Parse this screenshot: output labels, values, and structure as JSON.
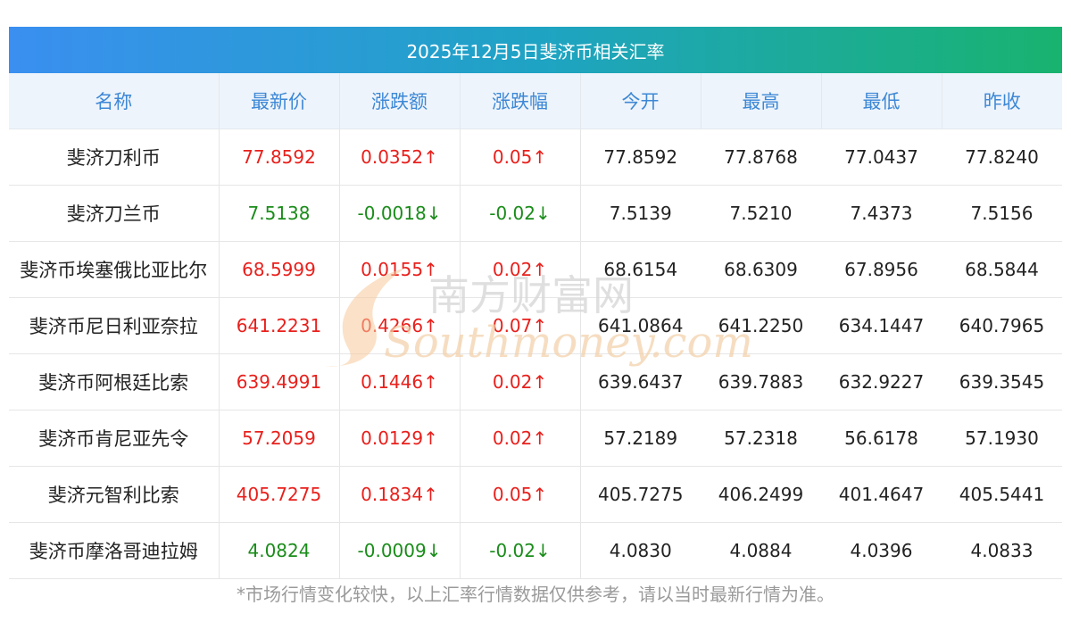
{
  "title": "2025年12月5日斐济币相关汇率",
  "columns": [
    "名称",
    "最新价",
    "涨跌额",
    "涨跌幅",
    "今开",
    "最高",
    "最低",
    "昨收"
  ],
  "rows": [
    {
      "name": "斐济刀利币",
      "latest": "77.8592",
      "change": "0.0352↑",
      "pct": "0.05↑",
      "open": "77.8592",
      "high": "77.8768",
      "low": "77.0437",
      "prev": "77.8240",
      "dir": "up"
    },
    {
      "name": "斐济刀兰币",
      "latest": "7.5138",
      "change": "-0.0018↓",
      "pct": "-0.02↓",
      "open": "7.5139",
      "high": "7.5210",
      "low": "7.4373",
      "prev": "7.5156",
      "dir": "down"
    },
    {
      "name": "斐济币埃塞俄比亚比尔",
      "latest": "68.5999",
      "change": "0.0155↑",
      "pct": "0.02↑",
      "open": "68.6154",
      "high": "68.6309",
      "low": "67.8956",
      "prev": "68.5844",
      "dir": "up"
    },
    {
      "name": "斐济币尼日利亚奈拉",
      "latest": "641.2231",
      "change": "0.4266↑",
      "pct": "0.07↑",
      "open": "641.0864",
      "high": "641.2250",
      "low": "634.1447",
      "prev": "640.7965",
      "dir": "up"
    },
    {
      "name": "斐济币阿根廷比索",
      "latest": "639.4991",
      "change": "0.1446↑",
      "pct": "0.02↑",
      "open": "639.6437",
      "high": "639.7883",
      "low": "632.9227",
      "prev": "639.3545",
      "dir": "up"
    },
    {
      "name": "斐济币肯尼亚先令",
      "latest": "57.2059",
      "change": "0.0129↑",
      "pct": "0.02↑",
      "open": "57.2189",
      "high": "57.2318",
      "low": "56.6178",
      "prev": "57.1930",
      "dir": "up"
    },
    {
      "name": "斐济元智利比索",
      "latest": "405.7275",
      "change": "0.1834↑",
      "pct": "0.05↑",
      "open": "405.7275",
      "high": "406.2499",
      "low": "401.4647",
      "prev": "405.5441",
      "dir": "up"
    },
    {
      "name": "斐济币摩洛哥迪拉姆",
      "latest": "4.0824",
      "change": "-0.0009↓",
      "pct": "-0.02↓",
      "open": "4.0830",
      "high": "4.0884",
      "low": "4.0396",
      "prev": "4.0833",
      "dir": "down"
    }
  ],
  "footer": "*市场行情变化较快，以上汇率行情数据仅供参考，请以当时最新行情为准。",
  "watermark": {
    "cn": "南方财富网",
    "en": "Southmoney.com"
  },
  "colors": {
    "up": "#e8201c",
    "down": "#1a8c1a",
    "header_text": "#3d88d6"
  }
}
